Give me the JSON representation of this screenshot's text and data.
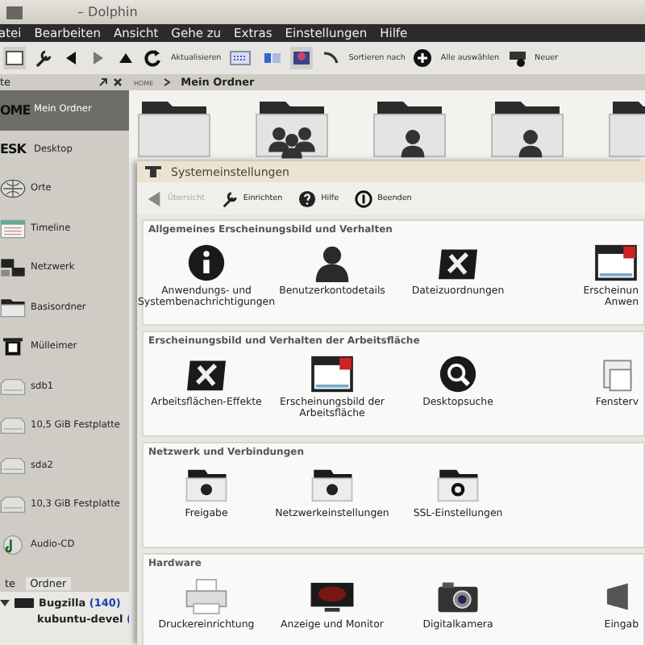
{
  "window": {
    "title": "– Dolphin"
  },
  "menu": [
    "atei",
    "Bearbeiten",
    "Ansicht",
    "Gehe zu",
    "Extras",
    "Einstellungen",
    "Hilfe"
  ],
  "toolbar": {
    "refresh_label": "Aktualisieren",
    "sort_label": "Sortieren nach",
    "select_all_label": "Alle auswählen",
    "new_label": "Neuer"
  },
  "panel": {
    "title": "te"
  },
  "breadcrumb": {
    "root": "HOME",
    "current": "Mein Ordner"
  },
  "places": [
    {
      "label": "Mein Ordner",
      "icon_text": "OME",
      "selected": true
    },
    {
      "label": "Desktop",
      "icon_text": "ESK",
      "selected": false
    },
    {
      "label": "Orte",
      "selected": false
    },
    {
      "label": "Timeline",
      "selected": false
    },
    {
      "label": "Netzwerk",
      "selected": false
    },
    {
      "label": "Basisordner",
      "selected": false
    },
    {
      "label": "Mülleimer",
      "selected": false
    },
    {
      "label": "sdb1",
      "selected": false
    },
    {
      "label": "10,5 GiB Festplatte",
      "selected": false
    },
    {
      "label": "sda2",
      "selected": false
    },
    {
      "label": "10,3 GiB Festplatte",
      "selected": false
    },
    {
      "label": "Audio-CD",
      "selected": false
    }
  ],
  "bottom_tabs": [
    {
      "label": "te",
      "selected": false
    },
    {
      "label": "Ordner",
      "selected": true
    }
  ],
  "tree": [
    {
      "label": "Bugzilla",
      "count": "(140)",
      "expanded": true,
      "children": [
        {
          "label": "kubuntu-devel",
          "count": "("
        }
      ]
    }
  ],
  "settings_window": {
    "title": "Systemeinstellungen",
    "toolbar": [
      {
        "label": "Übersicht",
        "disabled": true
      },
      {
        "label": "Einrichten",
        "disabled": false
      },
      {
        "label": "Hilfe",
        "disabled": false
      },
      {
        "label": "Beenden",
        "disabled": false
      }
    ],
    "sections": [
      {
        "title": "Allgemeines Erscheinungsbild und Verhalten",
        "items": [
          "Anwendungs- und Systembenachrichtigungen",
          "Benutzerkontodetails",
          "Dateizuordnungen",
          "Erscheinun\nAnwen"
        ]
      },
      {
        "title": "Erscheinungsbild und Verhalten der Arbeitsfläche",
        "items": [
          "Arbeitsflächen-Effekte",
          "Erscheinungsbild der Arbeitsfläche",
          "Desktopsuche",
          "Fensterv"
        ]
      },
      {
        "title": "Netzwerk und Verbindungen",
        "items": [
          "Freigabe",
          "Netzwerkeinstellungen",
          "SSL-Einstellungen"
        ]
      },
      {
        "title": "Hardware",
        "items": [
          "Druckereinrichtung",
          "Anzeige und Monitor",
          "Digitalkamera",
          "Eingab"
        ]
      }
    ]
  }
}
